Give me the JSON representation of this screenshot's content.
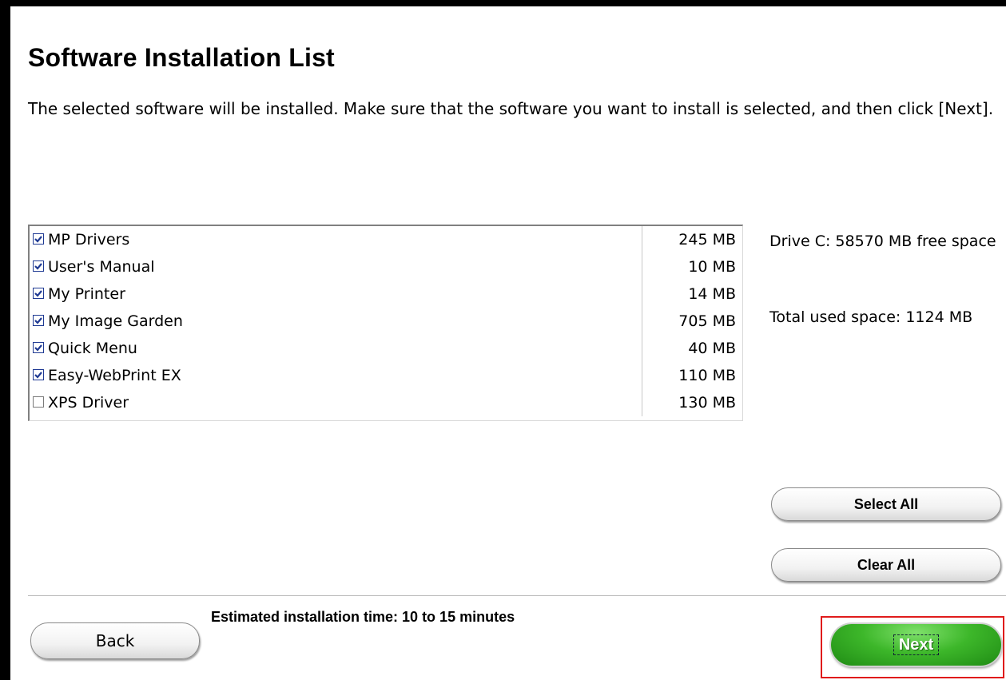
{
  "header": {
    "title": "Software Installation List",
    "description": "The selected software will be installed. Make sure that the software you want to install is selected, and then click [Next]."
  },
  "software_list": [
    {
      "name": "MP Drivers",
      "size": "245 MB",
      "checked": true
    },
    {
      "name": "User's Manual",
      "size": "10 MB",
      "checked": true
    },
    {
      "name": "My Printer",
      "size": "14 MB",
      "checked": true
    },
    {
      "name": "My Image Garden",
      "size": "705 MB",
      "checked": true
    },
    {
      "name": "Quick Menu",
      "size": "40 MB",
      "checked": true
    },
    {
      "name": "Easy-WebPrint EX",
      "size": "110 MB",
      "checked": true
    },
    {
      "name": "XPS Driver",
      "size": "130 MB",
      "checked": false
    }
  ],
  "disk": {
    "free_space": "Drive C: 58570 MB free space",
    "used_space": "Total used space: 1124 MB"
  },
  "buttons": {
    "select_all": "Select All",
    "clear_all": "Clear All",
    "back": "Back",
    "next": "Next"
  },
  "footer": {
    "estimate": "Estimated installation time: 10 to 15 minutes"
  },
  "colors": {
    "next_button": "#3db72a",
    "highlight": "#e01b1b",
    "checkbox_border": "#1f3a93"
  }
}
